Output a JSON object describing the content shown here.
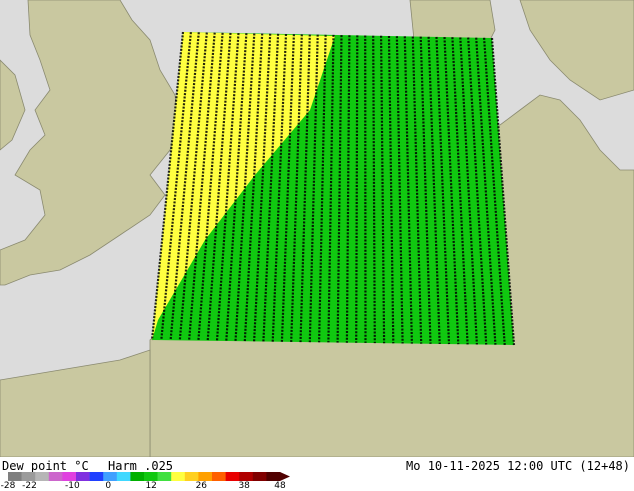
{
  "map": {
    "colors": {
      "sea": "#dcdcdc",
      "land": "#c9c8a0",
      "dry": "#ffff40",
      "moist": "#10c810"
    }
  },
  "legend": {
    "title": "Dew point °C",
    "model": "Harm .025",
    "ticks": [
      {
        "label": "-28",
        "value": -28
      },
      {
        "label": "-22",
        "value": -22
      },
      {
        "label": "-10",
        "value": -10
      },
      {
        "label": "0",
        "value": 0
      },
      {
        "label": "12",
        "value": 12
      },
      {
        "label": "26",
        "value": 26
      },
      {
        "label": "38",
        "value": 38
      },
      {
        "label": "48",
        "value": 48
      }
    ],
    "colors": [
      "#7f7f7f",
      "#9b9b9b",
      "#b6b6b6",
      "#cc66cc",
      "#e040e0",
      "#8030e0",
      "#2040ff",
      "#40a0ff",
      "#40d8ff",
      "#00b000",
      "#10c810",
      "#40e040",
      "#ffff40",
      "#ffd020",
      "#ffa000",
      "#ff6000",
      "#e80000",
      "#b00000",
      "#800000",
      "#500000"
    ]
  },
  "timestamp": "Mo 10-11-2025 12:00 UTC (12+48)"
}
